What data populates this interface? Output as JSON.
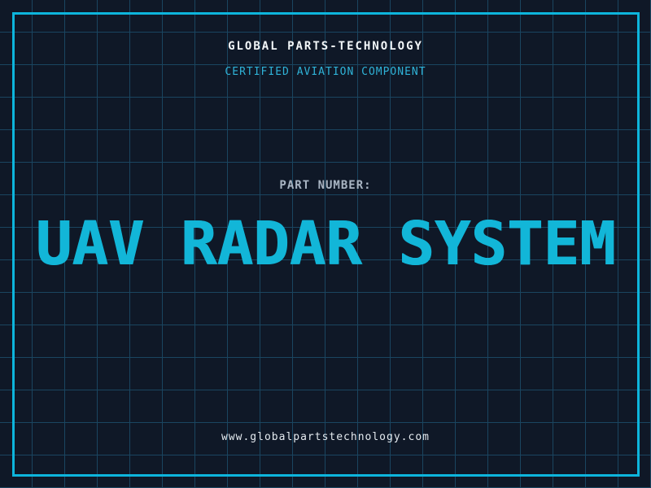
{
  "theme": {
    "background-color": "#0f1827",
    "grid-color": "#1a4560",
    "frame-color": "#0db5dc",
    "accent-cyan": "#12b6d8",
    "tagline-color": "#2fb3d8",
    "title-color": "#f2f6f8",
    "muted-label-color": "#a9b5c3",
    "footer-color": "#e4eaef"
  },
  "header": {
    "company_name": "GLOBAL PARTS-TECHNOLOGY",
    "tagline": "CERTIFIED AVIATION COMPONENT"
  },
  "part": {
    "label": "PART NUMBER:",
    "value": "UAV RADAR SYSTEM"
  },
  "footer": {
    "website_url": "www.globalpartstechnology.com"
  }
}
